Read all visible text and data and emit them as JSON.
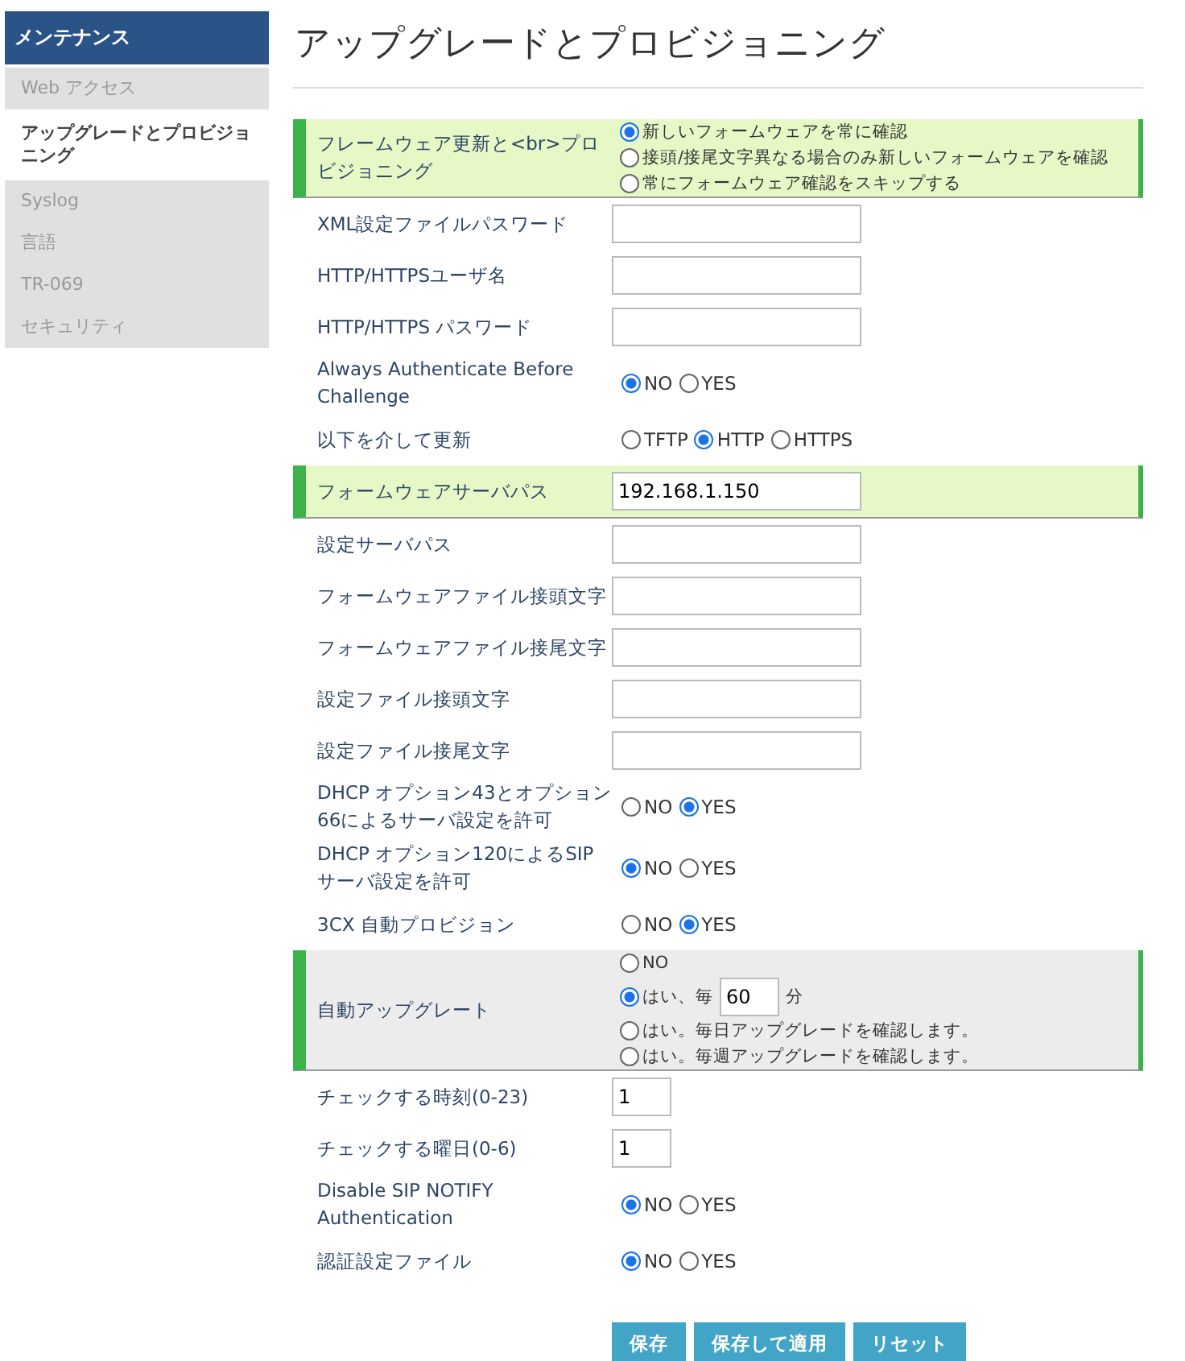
{
  "sidebar": {
    "header": "メンテナンス",
    "items": [
      {
        "label": "Web アクセス",
        "selected": false
      },
      {
        "label": "アップグレードとプロビジョニング",
        "selected": true
      },
      {
        "label": "Syslog",
        "selected": false
      },
      {
        "label": "言語",
        "selected": false
      },
      {
        "label": "TR-069",
        "selected": false
      },
      {
        "label": "セキュリティ",
        "selected": false
      }
    ]
  },
  "title": "アップグレードとプロビジョニング",
  "rows": [
    {
      "kind": "radio-stack",
      "color": "#e6f8c6",
      "label": "フレームウェア更新と<br>プロビジョニング",
      "options": [
        {
          "label": "新しいフォームウェアを常に確認",
          "selected": true
        },
        {
          "label": "接頭/接尾文字異なる場合のみ新しいフォームウェアを確認",
          "selected": false
        },
        {
          "label": "常にフォームウェア確認をスキップする",
          "selected": false
        }
      ]
    },
    {
      "kind": "field",
      "label": "XML設定ファイルパスワード"
    },
    {
      "kind": "field",
      "label": "HTTP/HTTPSユーザ名"
    },
    {
      "kind": "field",
      "label": "HTTP/HTTPS パスワード"
    },
    {
      "kind": "radio-inline",
      "label": "Always Authenticate Before Challenge",
      "options": [
        {
          "label": "NO",
          "selected": true
        },
        {
          "label": "YES",
          "selected": false
        }
      ]
    },
    {
      "kind": "radio-inline",
      "label": "以下を介して更新",
      "options": [
        {
          "label": "TFTP",
          "selected": false
        },
        {
          "label": "HTTP",
          "selected": true
        },
        {
          "label": "HTTPS",
          "selected": false
        }
      ]
    },
    {
      "kind": "field",
      "color": "#e6f8c6",
      "label": "フォームウェアサーバパス",
      "value": "192.168.1.150"
    },
    {
      "kind": "field",
      "label": "設定サーバパス"
    },
    {
      "kind": "field",
      "label": "フォームウェアファイル接頭文字"
    },
    {
      "kind": "field",
      "label": "フォームウェアファイル接尾文字"
    },
    {
      "kind": "field",
      "label": "設定ファイル接頭文字"
    },
    {
      "kind": "field",
      "label": "設定ファイル接尾文字"
    },
    {
      "kind": "radio-inline",
      "label": "DHCP オプション43とオプション66によるサーバ設定を許可",
      "options": [
        {
          "label": "NO",
          "selected": false
        },
        {
          "label": "YES",
          "selected": true
        }
      ]
    },
    {
      "kind": "radio-inline",
      "label": "DHCP オプション120によるSIPサーバ設定を許可",
      "options": [
        {
          "label": "NO",
          "selected": true
        },
        {
          "label": "YES",
          "selected": false
        }
      ]
    },
    {
      "kind": "radio-inline",
      "label": "3CX 自動プロビジョン",
      "options": [
        {
          "label": "NO",
          "selected": false
        },
        {
          "label": "YES",
          "selected": true
        }
      ]
    },
    {
      "kind": "radio-stack",
      "color": "#ececec",
      "label": "自動アップグレート",
      "options": [
        {
          "label": "NO",
          "selected": false
        },
        {
          "kind": "interval",
          "prefix": "はい、毎",
          "value": "60",
          "suffix": "分",
          "selected": true
        },
        {
          "label": "はい。毎日アップグレードを確認します。",
          "selected": false
        },
        {
          "label": "はい。毎週アップグレードを確認します。",
          "selected": false
        }
      ]
    },
    {
      "kind": "number",
      "label": "チェックする時刻(0-23)",
      "value": "1"
    },
    {
      "kind": "number",
      "label": "チェックする曜日(0-6)",
      "value": "1"
    },
    {
      "kind": "radio-inline",
      "label": "Disable SIP NOTIFY Authentication",
      "options": [
        {
          "label": "NO",
          "selected": true
        },
        {
          "label": "YES",
          "selected": false
        }
      ]
    },
    {
      "kind": "radio-inline",
      "label": "認証設定ファイル",
      "options": [
        {
          "label": "NO",
          "selected": true
        },
        {
          "label": "YES",
          "selected": false
        }
      ]
    }
  ],
  "buttons": [
    "保存",
    "保存して適用",
    "リセット"
  ]
}
